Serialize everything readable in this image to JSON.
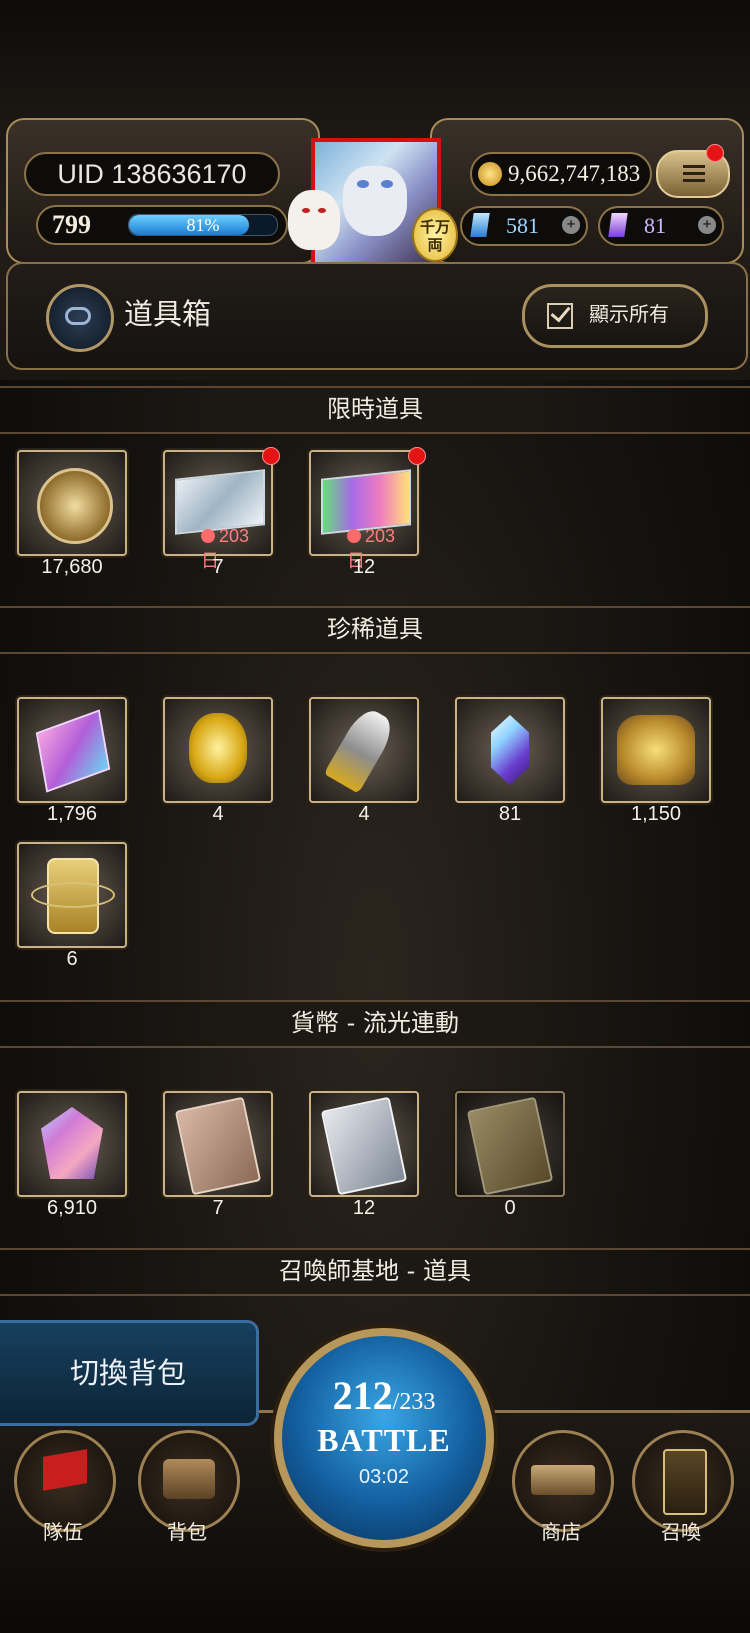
{
  "top": {
    "uid": "UID 138636170",
    "level": "799",
    "exp_percent": "81%",
    "exp_fraction": 0.81,
    "coins": "9,662,747,183",
    "blue_gems": "581",
    "purple_gems": "81",
    "badge_text": "千万両"
  },
  "header": {
    "title": "道具箱",
    "show_all": "顯示所有"
  },
  "sections": [
    {
      "title": "限時道具"
    },
    {
      "title": "珍稀道具"
    },
    {
      "title": "貨幣 - 流光連動"
    },
    {
      "title": "召喚師基地 - 道具"
    }
  ],
  "items": {
    "limited": [
      {
        "count": "17,680",
        "icon": "gold-coin-icon"
      },
      {
        "count": "7",
        "timer": "203 日",
        "icon": "silver-ticket-icon",
        "new": true
      },
      {
        "count": "12",
        "timer": "203 日",
        "icon": "rainbow-ticket-icon",
        "new": true
      }
    ],
    "rare": [
      {
        "count": "1,796",
        "icon": "pink-crystal-card-icon"
      },
      {
        "count": "4",
        "icon": "golden-heart-icon"
      },
      {
        "count": "4",
        "icon": "golden-horn-icon"
      },
      {
        "count": "81",
        "icon": "prism-crystal-icon"
      },
      {
        "count": "1,150",
        "icon": "leaf-sack-icon"
      },
      {
        "count": "6",
        "icon": "orbit-relic-icon"
      }
    ],
    "currency": [
      {
        "count": "6,910",
        "icon": "pink-gem-icon"
      },
      {
        "count": "7",
        "icon": "bronze-card-icon"
      },
      {
        "count": "12",
        "icon": "silver-card-icon"
      },
      {
        "count": "0",
        "icon": "gold-card-icon"
      }
    ]
  },
  "bottom": {
    "switch_bag": "切換背包",
    "nav": [
      {
        "label": "隊伍",
        "icon": "red-flag-icon"
      },
      {
        "label": "背包",
        "icon": "chest-icon"
      },
      {
        "label": "商店",
        "icon": "shop-sign-icon"
      },
      {
        "label": "召喚",
        "icon": "summon-card-icon"
      }
    ],
    "battle": {
      "stamina": "212",
      "stamina_max": "/233",
      "label": "BATTLE",
      "timer": "03:02"
    }
  },
  "colors": {
    "gold_trim": "#b89a62",
    "alert_red": "#e41414",
    "battle_blue": "#135e9e"
  }
}
